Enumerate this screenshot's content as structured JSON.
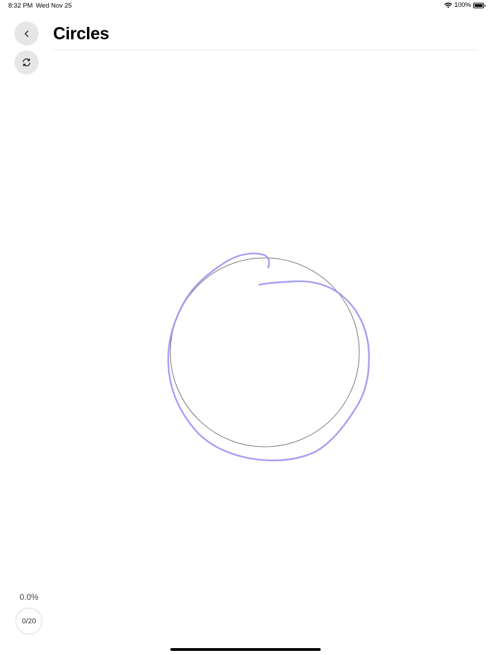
{
  "status_bar": {
    "time": "8:32 PM",
    "date": "Wed Nov 25",
    "battery_percent": "100%",
    "battery_level": 1.0
  },
  "header": {
    "title": "Circles"
  },
  "buttons": {
    "back_icon": "chevron-left-icon",
    "refresh_icon": "refresh-icon"
  },
  "score": {
    "percent": "0.0%",
    "progress": "0/20",
    "completed": 0,
    "total": 20
  },
  "colors": {
    "stroke": "#9a94f4",
    "target_circle": "#555555",
    "button_bg": "#e6e6e6",
    "ring": "#eeeeee"
  }
}
